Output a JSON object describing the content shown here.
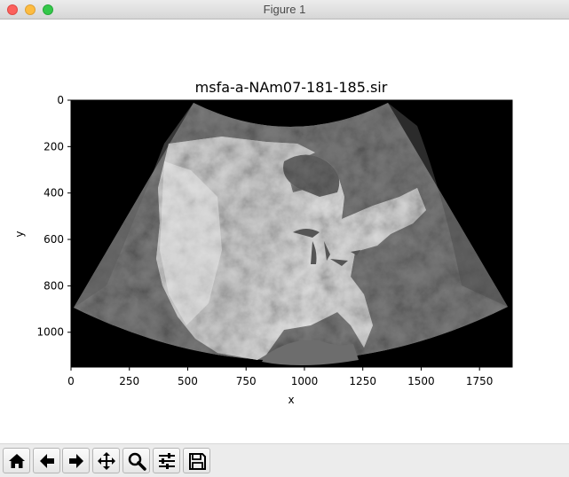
{
  "window": {
    "title": "Figure 1"
  },
  "toolbar": {
    "buttons": [
      {
        "name": "home",
        "icon": "home-icon"
      },
      {
        "name": "back",
        "icon": "arrow-left-icon"
      },
      {
        "name": "forward",
        "icon": "arrow-right-icon"
      },
      {
        "name": "pan",
        "icon": "move-icon"
      },
      {
        "name": "zoom",
        "icon": "magnifier-icon"
      },
      {
        "name": "configure-subplots",
        "icon": "sliders-icon"
      },
      {
        "name": "save",
        "icon": "floppy-disk-icon"
      }
    ]
  },
  "chart_data": {
    "type": "image",
    "title": "msfa-a-NAm07-181-185.sir",
    "xlabel": "x",
    "ylabel": "y",
    "xlim": [
      0,
      1890
    ],
    "ylim": [
      1150,
      0
    ],
    "yaxis_inverted": true,
    "xticks": [
      0,
      250,
      500,
      750,
      1000,
      1250,
      1500,
      1750
    ],
    "yticks": [
      0,
      200,
      400,
      600,
      800,
      1000
    ],
    "colormap": "gray",
    "background_color": "#000000"
  }
}
